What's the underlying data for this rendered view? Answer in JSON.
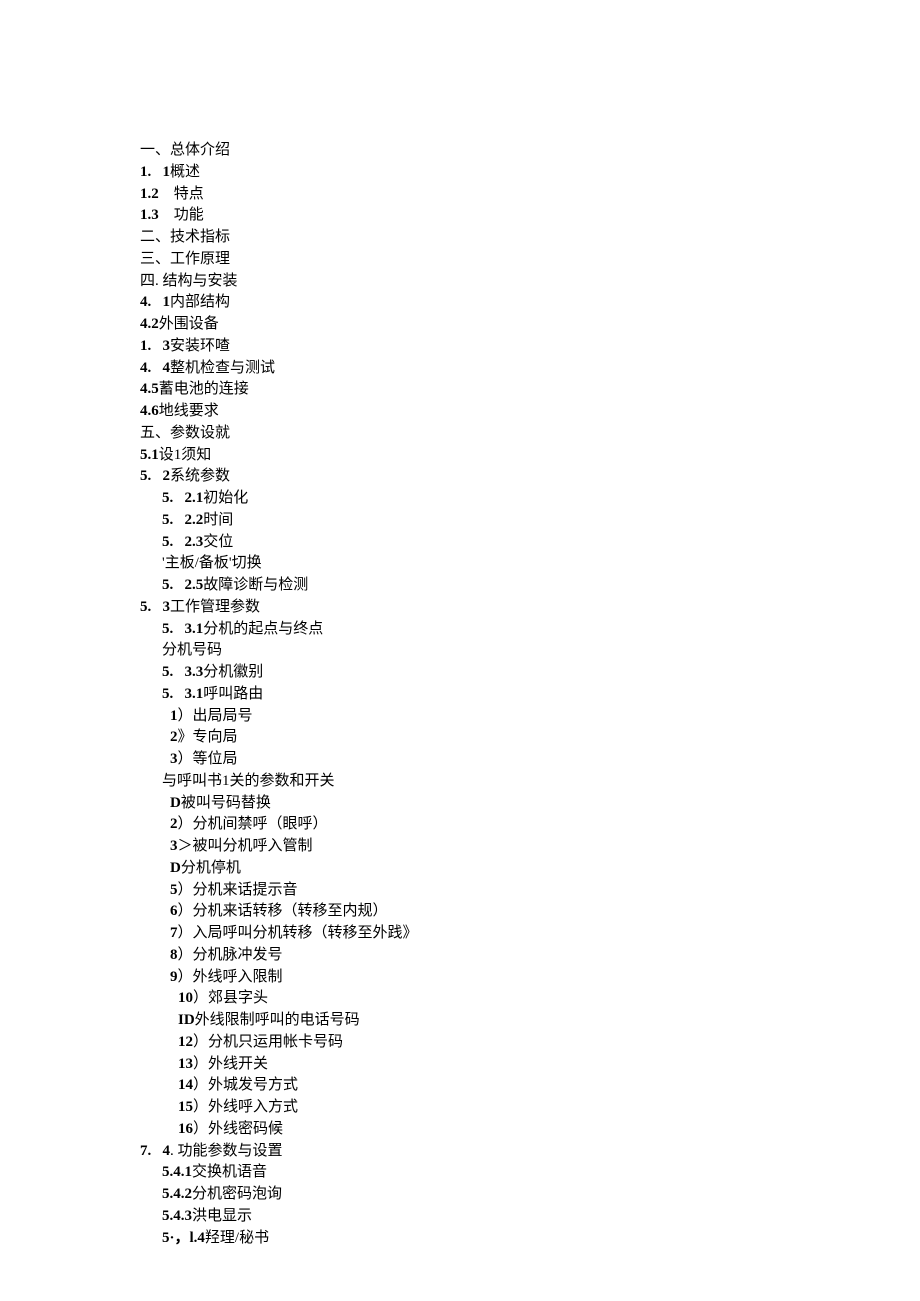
{
  "lines": [
    {
      "indent": 0,
      "segments": [
        {
          "t": "一、总体介绍"
        }
      ]
    },
    {
      "indent": 0,
      "segments": [
        {
          "t": "1.   1",
          "b": true
        },
        {
          "t": "概述"
        }
      ]
    },
    {
      "indent": 0,
      "segments": [
        {
          "t": "1.2",
          "b": true
        },
        {
          "t": "    特点"
        }
      ]
    },
    {
      "indent": 0,
      "segments": [
        {
          "t": "1.3",
          "b": true
        },
        {
          "t": "    功能"
        }
      ]
    },
    {
      "indent": 0,
      "segments": [
        {
          "t": "二、技术指标"
        }
      ]
    },
    {
      "indent": 0,
      "segments": [
        {
          "t": "三、工作原理"
        }
      ]
    },
    {
      "indent": 0,
      "segments": [
        {
          "t": "四. 结构与安装"
        }
      ]
    },
    {
      "indent": 0,
      "segments": [
        {
          "t": "4.   1",
          "b": true
        },
        {
          "t": "内部结构"
        }
      ]
    },
    {
      "indent": 0,
      "segments": [
        {
          "t": "4.2",
          "b": true
        },
        {
          "t": "外围设备"
        }
      ]
    },
    {
      "indent": 0,
      "segments": [
        {
          "t": "1.   3",
          "b": true
        },
        {
          "t": "安装环喳"
        }
      ]
    },
    {
      "indent": 0,
      "segments": [
        {
          "t": "4.   4",
          "b": true
        },
        {
          "t": "整机检查与测试"
        }
      ]
    },
    {
      "indent": 0,
      "segments": [
        {
          "t": "4.5",
          "b": true
        },
        {
          "t": "蓄电池的连接"
        }
      ]
    },
    {
      "indent": 0,
      "segments": [
        {
          "t": "4.6",
          "b": true
        },
        {
          "t": "地线要求"
        }
      ]
    },
    {
      "indent": 0,
      "segments": [
        {
          "t": "五、参数设就"
        }
      ]
    },
    {
      "indent": 0,
      "segments": [
        {
          "t": "5.1",
          "b": true
        },
        {
          "t": "设1须知"
        }
      ]
    },
    {
      "indent": 0,
      "segments": [
        {
          "t": "5.   2",
          "b": true
        },
        {
          "t": "系统参数"
        }
      ]
    },
    {
      "indent": 1,
      "segments": [
        {
          "t": "5.   2.1",
          "b": true
        },
        {
          "t": "初始化"
        }
      ]
    },
    {
      "indent": 1,
      "segments": [
        {
          "t": "5.   2.2",
          "b": true
        },
        {
          "t": "时间"
        }
      ]
    },
    {
      "indent": 1,
      "segments": [
        {
          "t": "5.   2.3",
          "b": true
        },
        {
          "t": "交位"
        }
      ]
    },
    {
      "indent": 1,
      "segments": [
        {
          "t": "'主板/备板'切换"
        }
      ]
    },
    {
      "indent": 1,
      "segments": [
        {
          "t": "5.   2.5",
          "b": true
        },
        {
          "t": "故障诊断与检测"
        }
      ]
    },
    {
      "indent": 0,
      "segments": [
        {
          "t": "5.   3",
          "b": true
        },
        {
          "t": "工作管理参数"
        }
      ]
    },
    {
      "indent": 1,
      "segments": [
        {
          "t": "5.   3.1",
          "b": true
        },
        {
          "t": "分机的起点与终点"
        }
      ]
    },
    {
      "indent": 1,
      "segments": [
        {
          "t": "分机号码"
        }
      ]
    },
    {
      "indent": 1,
      "segments": [
        {
          "t": "5.   3.3",
          "b": true
        },
        {
          "t": "分机徽别"
        }
      ]
    },
    {
      "indent": 1,
      "segments": [
        {
          "t": "5.   3.1",
          "b": true
        },
        {
          "t": "呼叫路由"
        }
      ]
    },
    {
      "indent": 2,
      "segments": [
        {
          "t": "1",
          "b": true
        },
        {
          "t": "）出局局号"
        }
      ]
    },
    {
      "indent": 2,
      "segments": [
        {
          "t": "2",
          "b": true
        },
        {
          "t": "》专向局"
        }
      ]
    },
    {
      "indent": 2,
      "segments": [
        {
          "t": "3",
          "b": true
        },
        {
          "t": "）等位局"
        }
      ]
    },
    {
      "indent": 1,
      "segments": [
        {
          "t": "与呼叫书1关的参数和开关"
        }
      ]
    },
    {
      "indent": 2,
      "segments": [
        {
          "t": "D",
          "b": true
        },
        {
          "t": "被叫号码替换"
        }
      ]
    },
    {
      "indent": 2,
      "segments": [
        {
          "t": "2",
          "b": true
        },
        {
          "t": "）分机间禁呼（眼呼）"
        }
      ]
    },
    {
      "indent": 2,
      "segments": [
        {
          "t": "3",
          "b": true
        },
        {
          "t": "＞被叫分机呼入管制"
        }
      ]
    },
    {
      "indent": 2,
      "segments": [
        {
          "t": "D",
          "b": true
        },
        {
          "t": "分机停机"
        }
      ]
    },
    {
      "indent": 2,
      "segments": [
        {
          "t": "5",
          "b": true
        },
        {
          "t": "）分机来话提示音"
        }
      ]
    },
    {
      "indent": 2,
      "segments": [
        {
          "t": "6",
          "b": true
        },
        {
          "t": "）分机来话转移（转移至内规）"
        }
      ]
    },
    {
      "indent": 2,
      "segments": [
        {
          "t": "7",
          "b": true
        },
        {
          "t": "）入局呼叫分机转移（转移至外践》"
        }
      ]
    },
    {
      "indent": 2,
      "segments": [
        {
          "t": "8",
          "b": true
        },
        {
          "t": "）分机脉冲发号"
        }
      ]
    },
    {
      "indent": 2,
      "segments": [
        {
          "t": "9",
          "b": true
        },
        {
          "t": "）外线呼入限制"
        }
      ]
    },
    {
      "indent": 3,
      "segments": [
        {
          "t": "10",
          "b": true
        },
        {
          "t": "）郊县字头"
        }
      ]
    },
    {
      "indent": 3,
      "segments": [
        {
          "t": "ID",
          "b": true
        },
        {
          "t": "外线限制呼叫的电话号码"
        }
      ]
    },
    {
      "indent": 3,
      "segments": [
        {
          "t": "12",
          "b": true
        },
        {
          "t": "）分机只运用帐卡号码"
        }
      ]
    },
    {
      "indent": 3,
      "segments": [
        {
          "t": "13",
          "b": true
        },
        {
          "t": "）外线开关"
        }
      ]
    },
    {
      "indent": 3,
      "segments": [
        {
          "t": "14",
          "b": true
        },
        {
          "t": "）外城发号方式"
        }
      ]
    },
    {
      "indent": 3,
      "segments": [
        {
          "t": "15",
          "b": true
        },
        {
          "t": "）外线呼入方式"
        }
      ]
    },
    {
      "indent": 3,
      "segments": [
        {
          "t": "16",
          "b": true
        },
        {
          "t": "）外线密码候"
        }
      ]
    },
    {
      "indent": 0,
      "segments": [
        {
          "t": "7.   4",
          "b": true
        },
        {
          "t": ". 功能参数与设置"
        }
      ]
    },
    {
      "indent": 1,
      "segments": [
        {
          "t": "5.4.1",
          "b": true
        },
        {
          "t": "交换机语音"
        }
      ]
    },
    {
      "indent": 1,
      "segments": [
        {
          "t": "5.4.2",
          "b": true
        },
        {
          "t": "分机密码泡询"
        }
      ]
    },
    {
      "indent": 1,
      "segments": [
        {
          "t": "5.4.3",
          "b": true
        },
        {
          "t": "洪电显示"
        }
      ]
    },
    {
      "indent": 1,
      "segments": [
        {
          "t": "5·，l.4",
          "b": true
        },
        {
          "t": "羟理/秘书"
        }
      ]
    }
  ]
}
